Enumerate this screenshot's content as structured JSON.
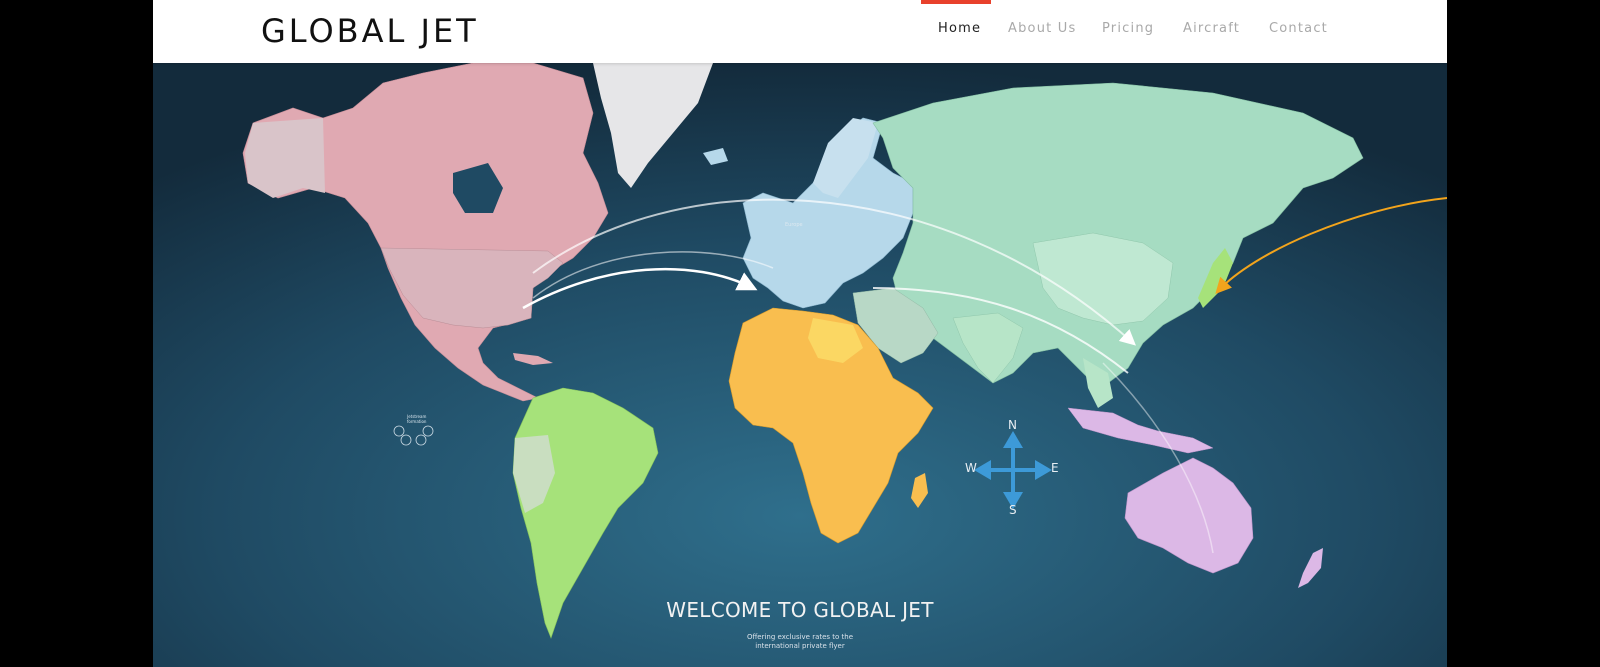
{
  "header": {
    "logo": "GLOBAL JET",
    "nav": [
      {
        "label": "Home",
        "active": true
      },
      {
        "label": "About Us",
        "active": false
      },
      {
        "label": "Pricing",
        "active": false
      },
      {
        "label": "Aircraft",
        "active": false
      },
      {
        "label": "Contact",
        "active": false
      }
    ],
    "accent_color": "#e8412c"
  },
  "hero": {
    "title": "WELCOME TO GLOBAL JET",
    "tagline_line1": "Offering exclusive rates to the",
    "tagline_line2": "international private flyer",
    "map_labels": {
      "europe": "Europe",
      "small_label_line1": "Jetstream",
      "small_label_line2": "formation"
    },
    "compass": {
      "north": "N",
      "south": "S",
      "east": "E",
      "west": "W"
    },
    "colors": {
      "ocean": "#1f4a63",
      "north_america": "#e0a9b2",
      "south_america": "#a6e27a",
      "europe": "#b6d8ea",
      "africa": "#f9be4f",
      "asia": "#a6dcc2",
      "oceania": "#dcb8e6",
      "greenland": "#e6e6e8",
      "compass": "#3d9ad8",
      "route_orange": "#f2a41c"
    }
  }
}
